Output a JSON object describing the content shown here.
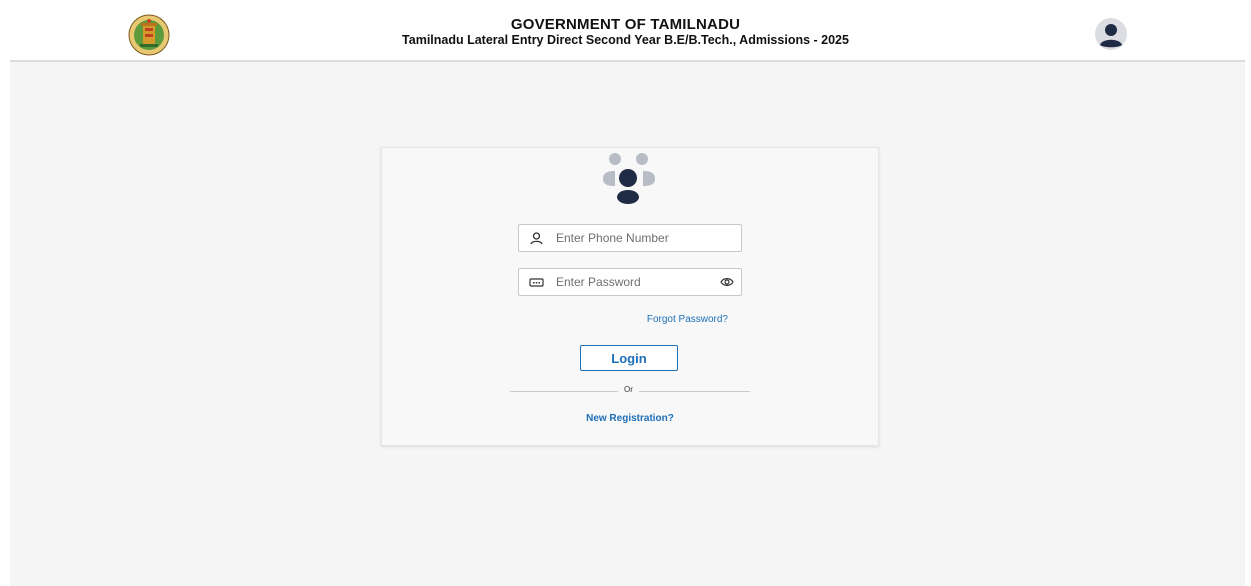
{
  "header": {
    "title": "GOVERNMENT OF TAMILNADU",
    "subtitle": "Tamilnadu Lateral Entry Direct Second Year B.E/B.Tech., Admissions - 2025",
    "logo_icon": "tamilnadu-emblem-icon",
    "profile_icon": "user-avatar-icon"
  },
  "login_form": {
    "header_icon": "users-group-icon",
    "phone": {
      "icon": "user-icon",
      "placeholder": "Enter Phone Number",
      "value": ""
    },
    "password": {
      "icon": "keyboard-password-icon",
      "placeholder": "Enter Password",
      "value": "",
      "toggle_icon": "eye-icon"
    },
    "forgot_password_label": "Forgot Password?",
    "login_label": "Login",
    "divider_label": "Or",
    "new_registration_label": "New Registration?"
  },
  "colors": {
    "link": "#1e6fb8",
    "avatar": "#1f2a44",
    "page_background": "#f5f5f5"
  }
}
